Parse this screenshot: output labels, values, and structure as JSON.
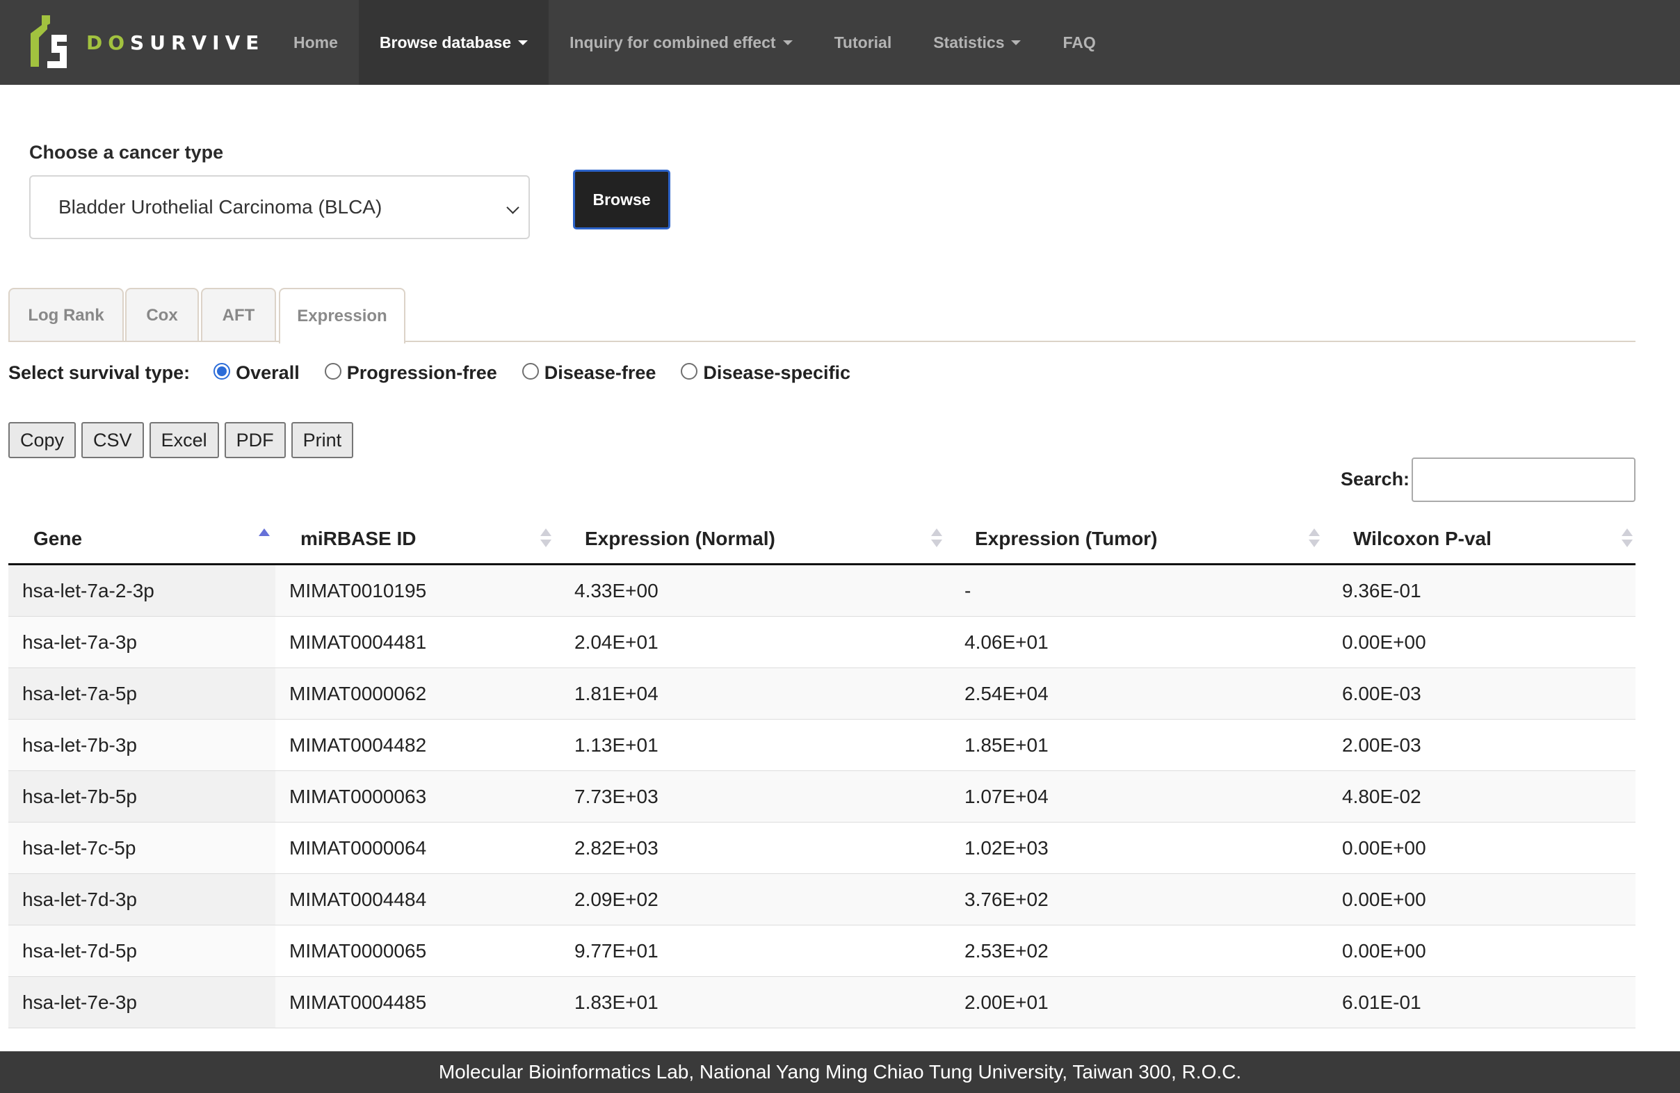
{
  "nav": {
    "logo_text_accent": "DO",
    "logo_text_main": "SURVIVE",
    "items": [
      {
        "label": "Home"
      },
      {
        "label": "Browse database"
      },
      {
        "label": "Inquiry for combined effect"
      },
      {
        "label": "Tutorial"
      },
      {
        "label": "Statistics"
      },
      {
        "label": "FAQ"
      }
    ]
  },
  "chooser": {
    "label": "Choose a cancer type",
    "selected": "Bladder Urothelial Carcinoma (BLCA)",
    "button": "Browse"
  },
  "tabs": [
    {
      "label": "Log Rank"
    },
    {
      "label": "Cox"
    },
    {
      "label": "AFT"
    },
    {
      "label": "Expression",
      "active": true
    }
  ],
  "survival": {
    "label": "Select survival type:",
    "options": [
      {
        "label": "Overall",
        "checked": true
      },
      {
        "label": "Progression-free"
      },
      {
        "label": "Disease-free"
      },
      {
        "label": "Disease-specific"
      }
    ]
  },
  "export_buttons": [
    {
      "label": "Copy"
    },
    {
      "label": "CSV"
    },
    {
      "label": "Excel"
    },
    {
      "label": "PDF"
    },
    {
      "label": "Print"
    }
  ],
  "search": {
    "label": "Search:",
    "value": ""
  },
  "table": {
    "columns": [
      "Gene",
      "miRBASE ID",
      "Expression (Normal)",
      "Expression (Tumor)",
      "Wilcoxon P-val"
    ],
    "sorted_column": "Gene",
    "sort_direction": "ascending",
    "rows": [
      [
        "hsa-let-7a-2-3p",
        "MIMAT0010195",
        "4.33E+00",
        "-",
        "9.36E-01"
      ],
      [
        "hsa-let-7a-3p",
        "MIMAT0004481",
        "2.04E+01",
        "4.06E+01",
        "0.00E+00"
      ],
      [
        "hsa-let-7a-5p",
        "MIMAT0000062",
        "1.81E+04",
        "2.54E+04",
        "6.00E-03"
      ],
      [
        "hsa-let-7b-3p",
        "MIMAT0004482",
        "1.13E+01",
        "1.85E+01",
        "2.00E-03"
      ],
      [
        "hsa-let-7b-5p",
        "MIMAT0000063",
        "7.73E+03",
        "1.07E+04",
        "4.80E-02"
      ],
      [
        "hsa-let-7c-5p",
        "MIMAT0000064",
        "2.82E+03",
        "1.02E+03",
        "0.00E+00"
      ],
      [
        "hsa-let-7d-3p",
        "MIMAT0004484",
        "2.09E+02",
        "3.76E+02",
        "0.00E+00"
      ],
      [
        "hsa-let-7d-5p",
        "MIMAT0000065",
        "9.77E+01",
        "2.53E+02",
        "0.00E+00"
      ],
      [
        "hsa-let-7e-3p",
        "MIMAT0004485",
        "1.83E+01",
        "2.00E+01",
        "6.01E-01"
      ]
    ]
  },
  "footer": {
    "text": "Molecular Bioinformatics Lab, National Yang Ming Chiao Tung University, Taiwan 300, R.O.C."
  },
  "colors": {
    "navbar": "#3f3f3f",
    "logo_accent": "#a2c23f",
    "radio_accent": "#2b6cd8",
    "browse_border": "#2c63c9"
  }
}
